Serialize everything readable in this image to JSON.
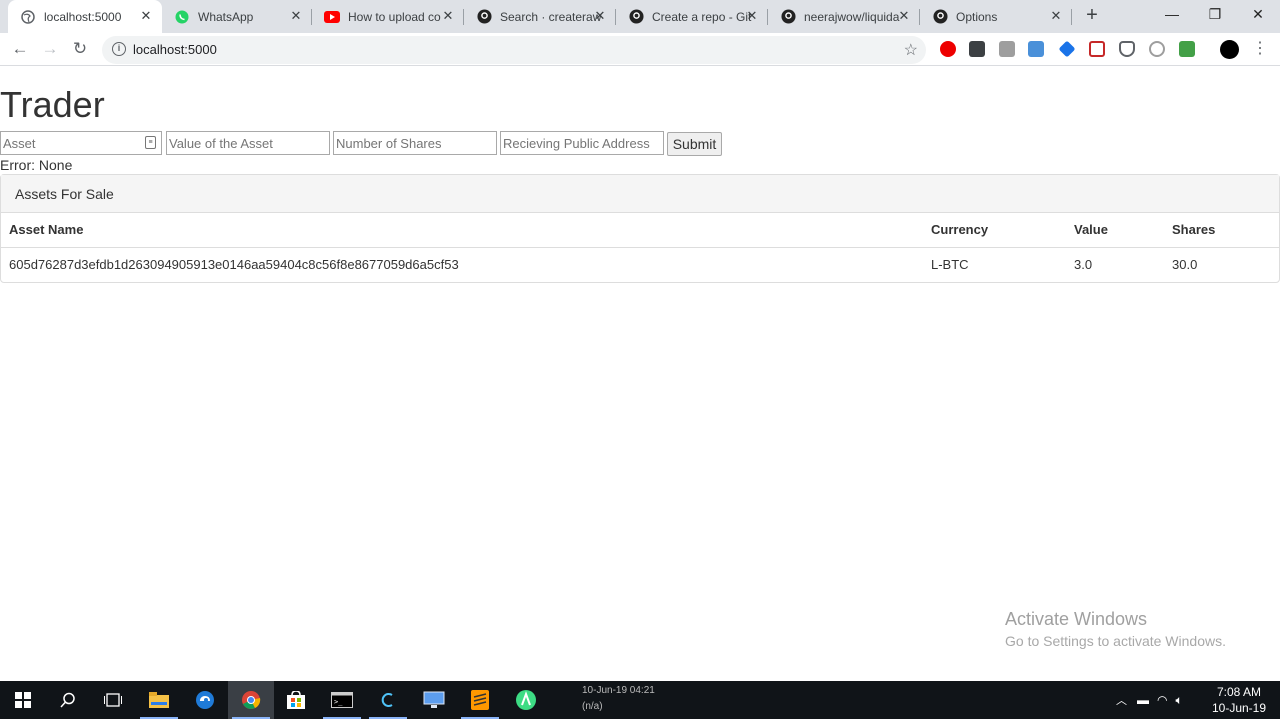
{
  "browser": {
    "tabs": [
      {
        "title": "localhost:5000",
        "active": true,
        "icon": "globe-icon"
      },
      {
        "title": "WhatsApp",
        "active": false,
        "icon": "whatsapp-icon"
      },
      {
        "title": "How to upload co",
        "active": false,
        "icon": "youtube-icon"
      },
      {
        "title": "Search · createraw",
        "active": false,
        "icon": "github-icon"
      },
      {
        "title": "Create a repo - Git",
        "active": false,
        "icon": "github-icon"
      },
      {
        "title": "neerajwow/liquida",
        "active": false,
        "icon": "github-icon"
      },
      {
        "title": "Options",
        "active": false,
        "icon": "github-icon"
      }
    ],
    "url": "localhost:5000"
  },
  "page": {
    "title": "Trader",
    "form": {
      "asset_placeholder": "Asset",
      "value_placeholder": "Value of the Asset",
      "shares_placeholder": "Number of Shares",
      "address_placeholder": "Recieving Public Address",
      "submit_label": "Submit"
    },
    "error_text": "Error: None",
    "panel_heading": "Assets For Sale",
    "table": {
      "headers": [
        "Asset Name",
        "Currency",
        "Value",
        "Shares"
      ],
      "rows": [
        [
          "605d76287d3efdb1d263094905913e0146aa59404c8c56f8e8677059d6a5cf53",
          "L-BTC",
          "3.0",
          "30.0"
        ]
      ]
    }
  },
  "watermark": {
    "line1": "Activate Windows",
    "line2": "Go to Settings to activate Windows."
  },
  "taskbar": {
    "ticker_date": "10-Jun-19 04:21",
    "ticker_sub": "(n/a)",
    "time": "7:08 AM",
    "date": "10-Jun-19"
  }
}
